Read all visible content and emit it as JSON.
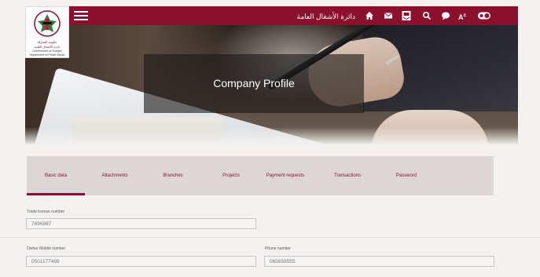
{
  "brand": {
    "logo_line1": "حكومة الشارقة",
    "logo_line2": "دائرة الأشغال العامة",
    "logo_line3": "Government of Sharjah",
    "logo_line4": "Department of Public Works"
  },
  "topbar": {
    "department_name": "دائرة الأشغال العامة",
    "accessibility_label": "A",
    "icons": [
      "home-icon",
      "mail-icon",
      "inbox-icon",
      "search-icon",
      "chat-icon",
      "text-size-icon",
      "contrast-toggle-icon"
    ],
    "accent_color": "#8b0f2e"
  },
  "hero": {
    "title": "Company Profile"
  },
  "tabs": [
    {
      "label": "Basic data",
      "active": true
    },
    {
      "label": "Attachments",
      "active": false
    },
    {
      "label": "Branches",
      "active": false
    },
    {
      "label": "Projects",
      "active": false
    },
    {
      "label": "Payment requests",
      "active": false
    },
    {
      "label": "Transactions",
      "active": false
    },
    {
      "label": "Password",
      "active": false
    }
  ],
  "form": {
    "trade_license": {
      "label": "Trade license number",
      "value": "7896987"
    },
    "owner_mobile": {
      "label": "Owner Mobile number",
      "value": "0501177499"
    },
    "phone": {
      "label": "Phone number",
      "value": "065658555"
    }
  }
}
